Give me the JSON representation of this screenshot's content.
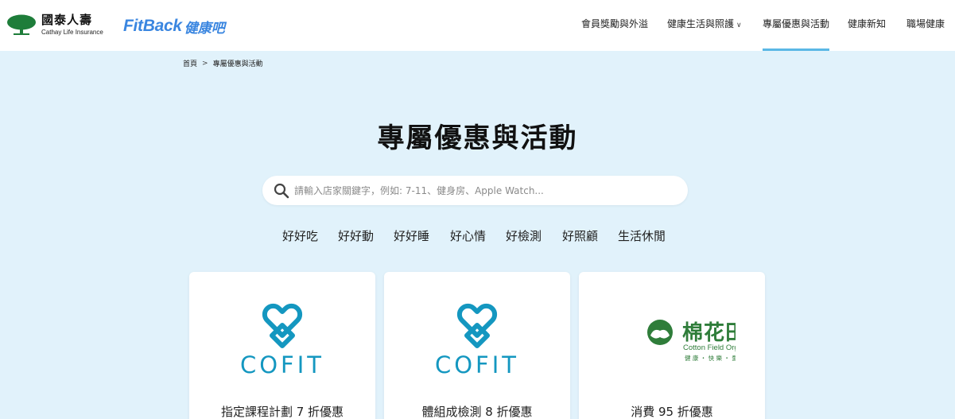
{
  "header": {
    "brand_zh": "國泰人壽",
    "brand_en": "Cathay Life Insurance",
    "fitback_en": "FitBack",
    "fitback_zh": "健康吧",
    "brand_color": "#1e7d3a",
    "accent_color": "#3a86e0",
    "nav": [
      {
        "label": "會員獎勵與外溢"
      },
      {
        "label": "健康生活與照護",
        "has_dropdown": true
      },
      {
        "label": "專屬優惠與活動",
        "active": true
      },
      {
        "label": "健康新知"
      },
      {
        "label": "職場健康"
      }
    ]
  },
  "breadcrumb": {
    "home": "首頁",
    "current": "專屬優惠與活動"
  },
  "page": {
    "title": "專屬優惠與活動"
  },
  "search": {
    "placeholder": "請輸入店家關鍵字，例如: 7-11、健身房、Apple Watch...",
    "value": ""
  },
  "categories": [
    "好好吃",
    "好好動",
    "好好睡",
    "好心情",
    "好檢測",
    "好照顧",
    "生活休閒"
  ],
  "cards": [
    {
      "logo_text": "COFIT",
      "logo_icon": "cofit-logo",
      "title": "指定課程計劃 7 折優惠"
    },
    {
      "logo_text": "COFIT",
      "logo_icon": "cofit-logo",
      "title": "體組成檢測 8 折優惠"
    },
    {
      "logo_zh": "棉花田",
      "logo_en": "Cotton Field Organic",
      "logo_tagline": "健 康 ・ 快 樂 ・ 愛",
      "logo_icon": "cotton-field-logo",
      "title": "消費 95 折優惠"
    }
  ]
}
